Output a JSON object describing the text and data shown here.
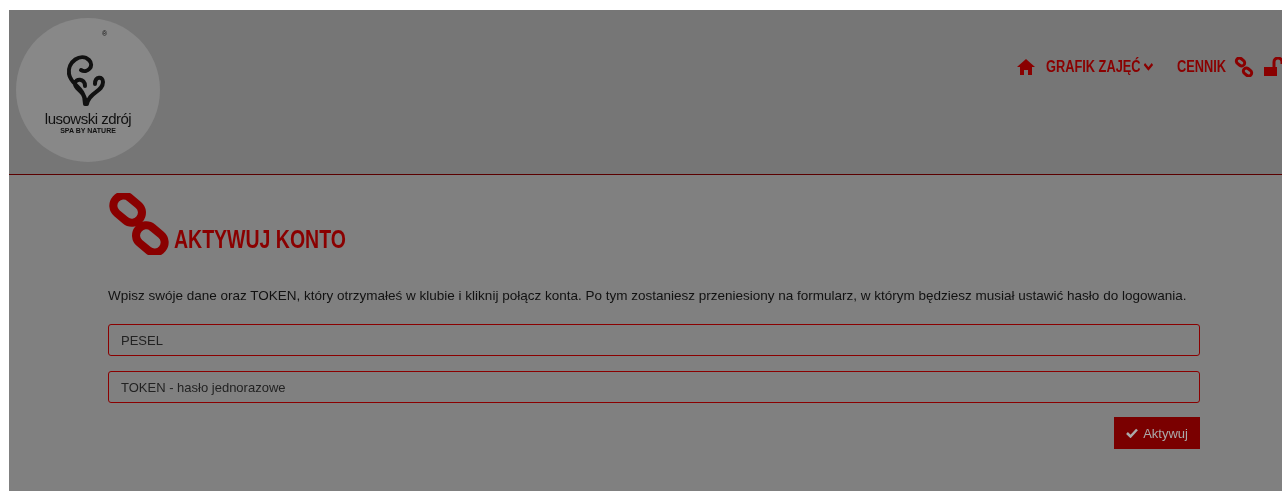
{
  "logo": {
    "name": "lusowski zdrój",
    "tagline": "SPA BY NATURE",
    "mark": "®"
  },
  "nav": [
    {
      "kind": "home"
    },
    {
      "kind": "dropdown",
      "label": "GRAFIK ZAJĘĆ"
    },
    {
      "kind": "link",
      "label": "CENNIK"
    },
    {
      "kind": "chain"
    },
    {
      "kind": "lock"
    }
  ],
  "page": {
    "title": "AKTYWUJ KONTO",
    "intro": "Wpisz swóje dane oraz TOKEN, który otrzymałeś w klubie i kliknij połącz konta. Po tym zostaniesz przeniesiony na formularz, w którym będziesz musiał ustawić hasło do logowania.",
    "fields": [
      {
        "placeholder": "PESEL"
      },
      {
        "placeholder": "TOKEN - hasło jednorazowe"
      }
    ],
    "submit": "Aktywuj"
  }
}
